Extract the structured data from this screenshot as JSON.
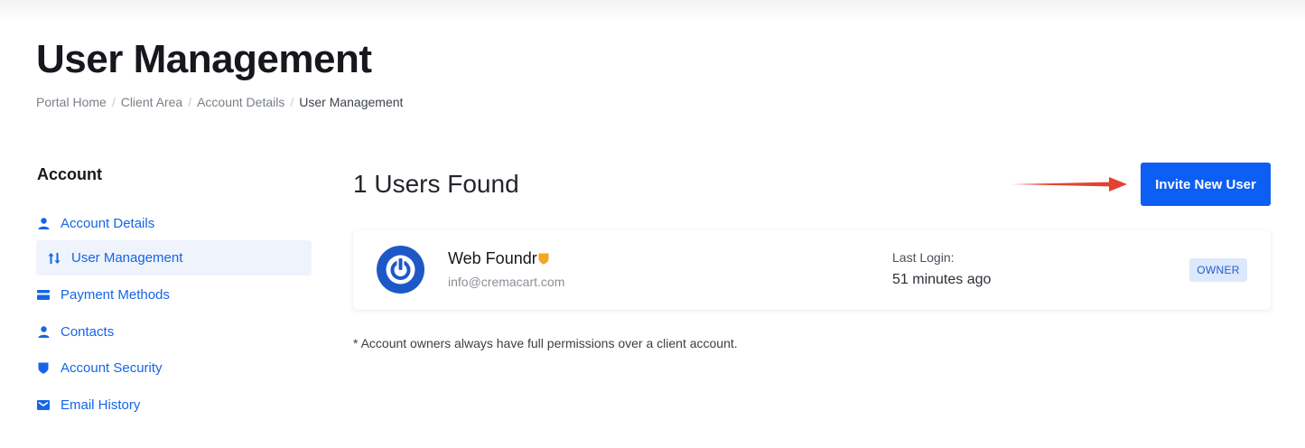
{
  "page": {
    "title": "User Management",
    "breadcrumb": [
      "Portal Home",
      "Client Area",
      "Account Details",
      "User Management"
    ]
  },
  "sidebar": {
    "heading": "Account",
    "items": [
      {
        "label": "Account Details",
        "icon": "user-icon",
        "active": false
      },
      {
        "label": "User Management",
        "icon": "sort-arrows-icon",
        "active": true
      },
      {
        "label": "Payment Methods",
        "icon": "credit-card-icon",
        "active": false
      },
      {
        "label": "Contacts",
        "icon": "user-icon",
        "active": false
      },
      {
        "label": "Account Security",
        "icon": "shield-icon",
        "active": false
      },
      {
        "label": "Email History",
        "icon": "envelope-icon",
        "active": false
      }
    ]
  },
  "main": {
    "users_found": "1 Users Found",
    "invite_button": "Invite New User",
    "users": [
      {
        "name": "Web Foundr",
        "email": "info@cremacart.com",
        "last_login_label": "Last Login:",
        "last_login_value": "51 minutes ago",
        "badge": "OWNER"
      }
    ],
    "footnote": "* Account owners always have full permissions over a client account."
  },
  "colors": {
    "accent": "#0d5ef5",
    "link": "#1565e6",
    "arrow": "#e2432f",
    "shield": "#f5a623",
    "badge_bg": "#dce8fb"
  }
}
